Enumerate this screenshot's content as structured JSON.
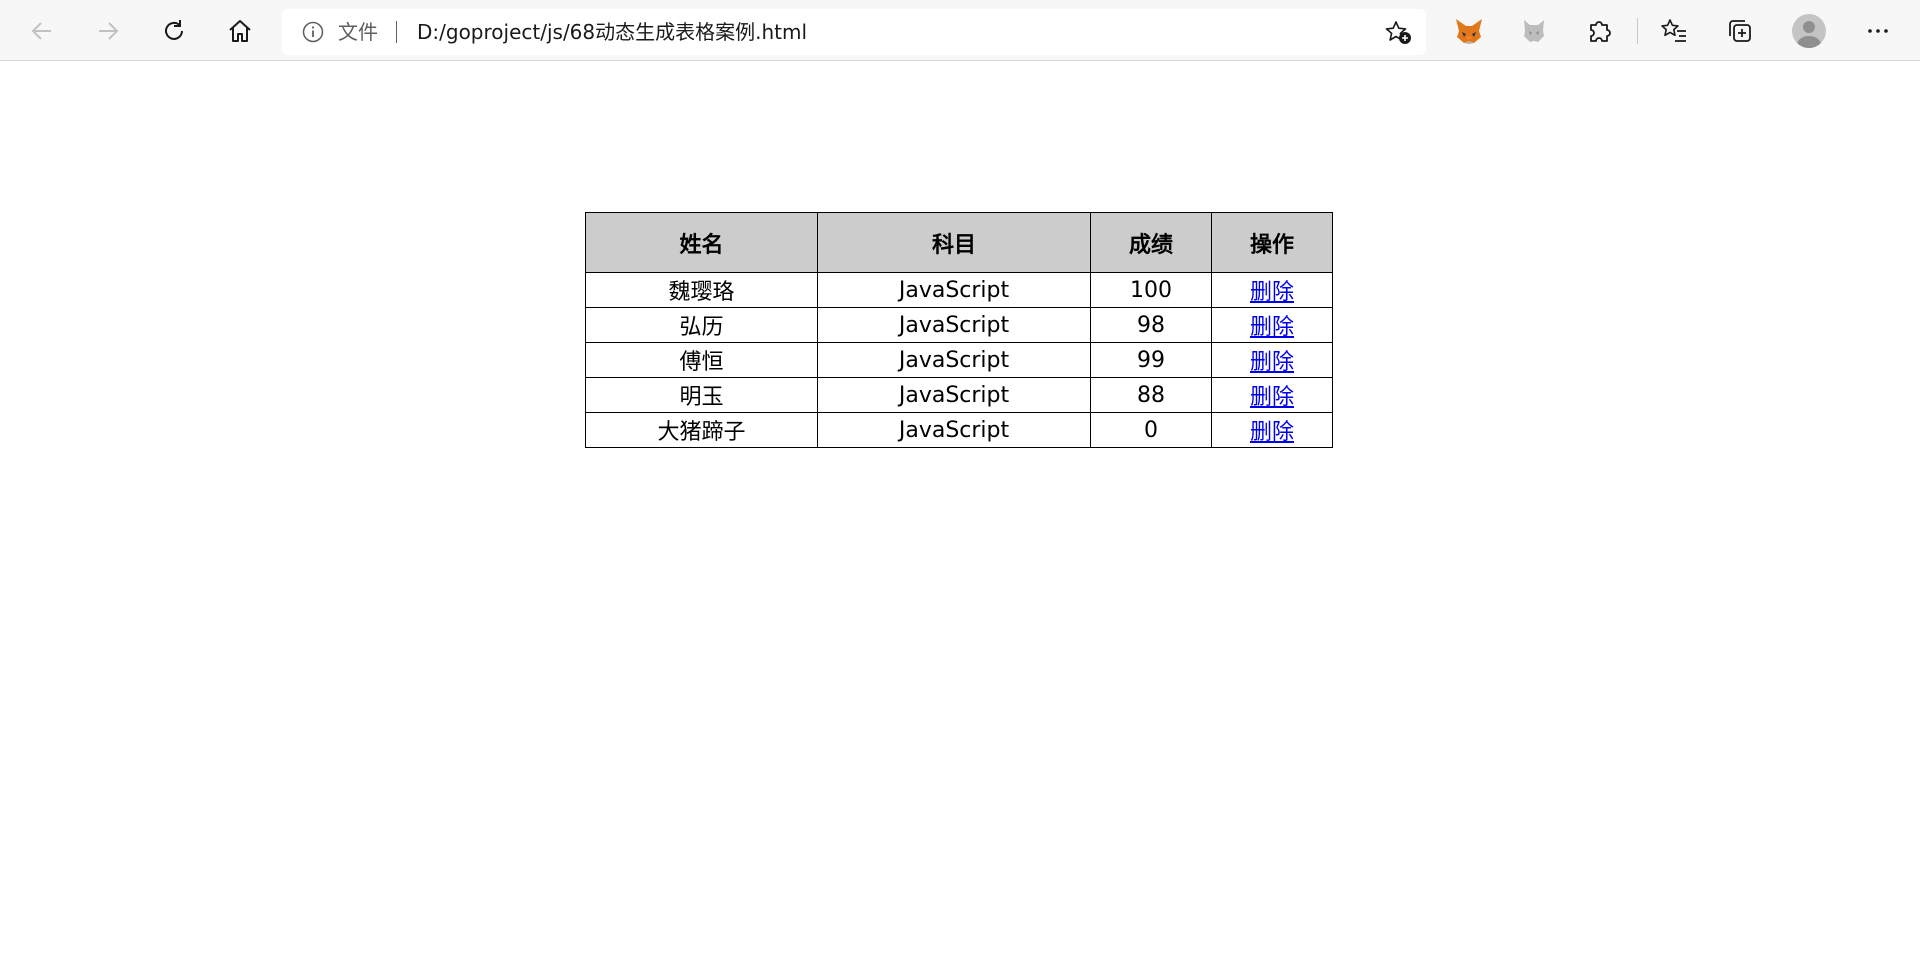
{
  "browser": {
    "address_bar": {
      "scheme_label": "文件",
      "url": "D:/goproject/js/68动态生成表格案例.html"
    }
  },
  "table": {
    "headers": [
      "姓名",
      "科目",
      "成绩",
      "操作"
    ],
    "rows": [
      {
        "name": "魏璎珞",
        "subject": "JavaScript",
        "score": "100",
        "action": "删除"
      },
      {
        "name": "弘历",
        "subject": "JavaScript",
        "score": "98",
        "action": "删除"
      },
      {
        "name": "傅恒",
        "subject": "JavaScript",
        "score": "99",
        "action": "删除"
      },
      {
        "name": "明玉",
        "subject": "JavaScript",
        "score": "88",
        "action": "删除"
      },
      {
        "name": "大猪蹄子",
        "subject": "JavaScript",
        "score": "0",
        "action": "删除"
      }
    ]
  },
  "colors": {
    "header_bg": "#cccccc",
    "link": "#0000ee",
    "toolbar_bg": "#f7f7f7"
  }
}
